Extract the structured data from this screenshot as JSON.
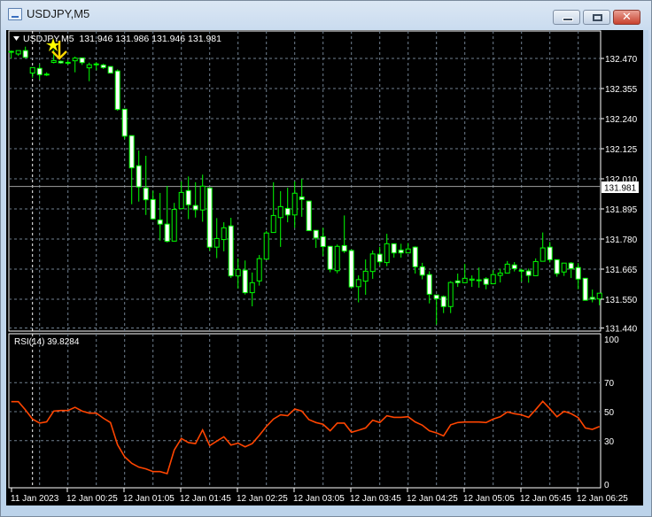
{
  "window": {
    "title": "USDJPY,M5",
    "buttons": {
      "minimize": "minimize",
      "maximize": "maximize",
      "close": "✕"
    }
  },
  "main_pane": {
    "header": "USDJPY,M5  131.946 131.986 131.946 131.981",
    "current_price": "131.981",
    "price_ticks": [
      "132.470",
      "132.355",
      "132.240",
      "132.125",
      "132.010",
      "131.895",
      "131.780",
      "131.665",
      "131.550",
      "131.440"
    ]
  },
  "rsi_pane": {
    "label": "RSI(14) 39.8284",
    "ticks": [
      "100",
      "70",
      "50",
      "30",
      "0"
    ]
  },
  "time_axis": [
    "11 Jan 2023",
    "12 Jan 00:25",
    "12 Jan 01:05",
    "12 Jan 01:45",
    "12 Jan 02:25",
    "12 Jan 03:05",
    "12 Jan 03:45",
    "12 Jan 04:25",
    "12 Jan 05:05",
    "12 Jan 05:45",
    "12 Jan 06:25"
  ],
  "colors": {
    "background": "#000000",
    "candle": "#00ff00",
    "grid": "#708090",
    "rsi": "#ff4500",
    "objects": "#ffff00",
    "axis_text": "#ffffff"
  },
  "objects": [
    "star-icon",
    "down-arrow-icon"
  ],
  "chart_data": [
    {
      "type": "candlestick",
      "symbol": "USDJPY",
      "timeframe": "M5",
      "ylim": [
        131.44,
        132.47
      ],
      "grid": true,
      "ohlc": [
        [
          132.495,
          132.5,
          132.47,
          132.497
        ],
        [
          132.487,
          132.5,
          132.48,
          132.5
        ],
        [
          132.5,
          132.515,
          132.474,
          132.474
        ],
        [
          132.414,
          132.435,
          132.396,
          132.435
        ],
        [
          132.432,
          132.447,
          132.389,
          132.408
        ],
        [
          132.41,
          132.417,
          132.403,
          132.409
        ],
        [
          132.455,
          132.504,
          132.451,
          132.462
        ],
        [
          132.459,
          132.462,
          132.45,
          132.453
        ],
        [
          132.455,
          132.463,
          132.446,
          132.455
        ],
        [
          132.461,
          132.477,
          132.417,
          132.471
        ],
        [
          132.472,
          132.472,
          132.445,
          132.454
        ],
        [
          132.434,
          132.454,
          132.383,
          132.446
        ],
        [
          132.449,
          132.456,
          132.425,
          132.449
        ],
        [
          132.445,
          132.45,
          132.43,
          132.435
        ],
        [
          132.439,
          132.439,
          132.414,
          132.414
        ],
        [
          132.422,
          132.428,
          132.27,
          132.275
        ],
        [
          132.276,
          132.276,
          132.162,
          132.173
        ],
        [
          132.175,
          132.175,
          131.913,
          132.052
        ],
        [
          132.06,
          132.118,
          131.923,
          131.979
        ],
        [
          131.975,
          132.098,
          131.872,
          131.93
        ],
        [
          131.931,
          131.964,
          131.854,
          131.857
        ],
        [
          131.853,
          131.956,
          131.774,
          131.837
        ],
        [
          131.837,
          131.983,
          131.767,
          131.771
        ],
        [
          131.772,
          131.918,
          131.771,
          131.893
        ],
        [
          131.896,
          132.0,
          131.895,
          131.958
        ],
        [
          131.965,
          132.019,
          131.856,
          131.911
        ],
        [
          131.908,
          131.997,
          131.862,
          131.892
        ],
        [
          131.891,
          132.026,
          131.846,
          131.982
        ],
        [
          131.975,
          131.975,
          131.735,
          131.749
        ],
        [
          131.749,
          131.86,
          131.707,
          131.782
        ],
        [
          131.778,
          131.844,
          131.733,
          131.823
        ],
        [
          131.83,
          131.861,
          131.631,
          131.639
        ],
        [
          131.639,
          131.706,
          131.591,
          131.664
        ],
        [
          131.661,
          131.698,
          131.568,
          131.575
        ],
        [
          131.575,
          131.652,
          131.523,
          131.613
        ],
        [
          131.62,
          131.719,
          131.602,
          131.705
        ],
        [
          131.703,
          131.811,
          131.702,
          131.803
        ],
        [
          131.805,
          131.997,
          131.804,
          131.87
        ],
        [
          131.862,
          131.963,
          131.75,
          131.904
        ],
        [
          131.897,
          131.976,
          131.844,
          131.872
        ],
        [
          131.872,
          132.0,
          131.823,
          131.955
        ],
        [
          131.941,
          132.01,
          131.865,
          131.931
        ],
        [
          131.925,
          131.925,
          131.812,
          131.812
        ],
        [
          131.813,
          131.813,
          131.746,
          131.784
        ],
        [
          131.789,
          131.823,
          131.715,
          131.751
        ],
        [
          131.752,
          131.752,
          131.653,
          131.664
        ],
        [
          131.659,
          131.759,
          131.649,
          131.752
        ],
        [
          131.755,
          131.87,
          131.727,
          131.734
        ],
        [
          131.736,
          131.741,
          131.591,
          131.597
        ],
        [
          131.598,
          131.641,
          131.538,
          131.625
        ],
        [
          131.619,
          131.702,
          131.567,
          131.657
        ],
        [
          131.656,
          131.736,
          131.628,
          131.723
        ],
        [
          131.722,
          131.75,
          131.679,
          131.693
        ],
        [
          131.69,
          131.8,
          131.676,
          131.762
        ],
        [
          131.762,
          131.762,
          131.709,
          131.727
        ],
        [
          131.738,
          131.762,
          131.709,
          131.727
        ],
        [
          131.727,
          131.765,
          131.726,
          131.742
        ],
        [
          131.749,
          131.752,
          131.648,
          131.674
        ],
        [
          131.674,
          131.689,
          131.626,
          131.642
        ],
        [
          131.644,
          131.657,
          131.534,
          131.569
        ],
        [
          131.566,
          131.566,
          131.453,
          131.552
        ],
        [
          131.56,
          131.564,
          131.497,
          131.522
        ],
        [
          131.522,
          131.619,
          131.497,
          131.614
        ],
        [
          131.62,
          131.648,
          131.597,
          131.613
        ],
        [
          131.613,
          131.685,
          131.612,
          131.63
        ],
        [
          131.623,
          131.641,
          131.597,
          131.627
        ],
        [
          131.623,
          131.671,
          131.594,
          131.624
        ],
        [
          131.628,
          131.634,
          131.588,
          131.607
        ],
        [
          131.609,
          131.661,
          131.608,
          131.644
        ],
        [
          131.641,
          131.667,
          131.614,
          131.65
        ],
        [
          131.65,
          131.696,
          131.649,
          131.684
        ],
        [
          131.681,
          131.692,
          131.656,
          131.667
        ],
        [
          131.661,
          131.667,
          131.617,
          131.657
        ],
        [
          131.658,
          131.667,
          131.613,
          131.641
        ],
        [
          131.64,
          131.706,
          131.639,
          131.694
        ],
        [
          131.695,
          131.805,
          131.694,
          131.746
        ],
        [
          131.749,
          131.769,
          131.69,
          131.701
        ],
        [
          131.701,
          131.701,
          131.636,
          131.648
        ],
        [
          131.654,
          131.689,
          131.639,
          131.688
        ],
        [
          131.688,
          131.692,
          131.631,
          131.667
        ],
        [
          131.671,
          131.688,
          131.588,
          131.627
        ],
        [
          131.63,
          131.63,
          131.546,
          131.546
        ],
        [
          131.557,
          131.587,
          131.538,
          131.55
        ],
        [
          131.551,
          131.573,
          131.527,
          131.573
        ]
      ]
    },
    {
      "type": "line",
      "name": "RSI(14)",
      "ylim": [
        0,
        100
      ],
      "levels": [
        70,
        50,
        30
      ],
      "values": [
        56.9,
        56.9,
        51.2,
        44.9,
        42.1,
        43.0,
        50.4,
        50.8,
        50.8,
        53.0,
        50.4,
        49.0,
        49.0,
        45.5,
        42.5,
        27.2,
        18.9,
        14.4,
        11.8,
        10.6,
        8.7,
        8.7,
        7.3,
        23.6,
        31.5,
        28.7,
        28.0,
        37.4,
        26.6,
        29.7,
        32.7,
        27.0,
        28.3,
        25.8,
        28.0,
        33.7,
        39.8,
        44.9,
        47.8,
        47.2,
        51.8,
        50.4,
        44.5,
        42.5,
        41.3,
        36.8,
        42.1,
        42.1,
        35.8,
        37.2,
        38.8,
        44.1,
        42.5,
        47.2,
        46.1,
        46.1,
        46.5,
        42.9,
        40.7,
        36.8,
        35.4,
        33.3,
        40.9,
        42.5,
        42.9,
        42.9,
        42.9,
        42.5,
        44.9,
        46.5,
        49.8,
        48.6,
        47.8,
        46.1,
        51.4,
        57.1,
        52.0,
        46.5,
        50.2,
        48.6,
        45.9,
        38.8,
        37.8,
        39.8
      ]
    }
  ]
}
